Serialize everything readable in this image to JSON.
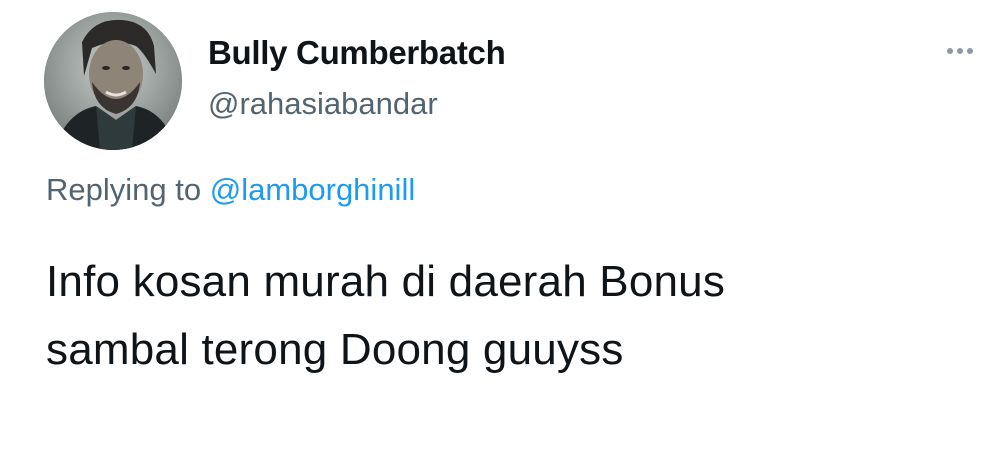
{
  "author": {
    "display_name": "Bully Cumberbatch",
    "handle": "@rahasiabandar"
  },
  "reply": {
    "prefix": "Replying to",
    "mention": "@lamborghinill"
  },
  "tweet": {
    "lines": [
      "Info kosan murah di daerah Bonus",
      "sambal terong Doong guuyss"
    ]
  },
  "icons": {
    "more": "more-horizontal-icon"
  },
  "colors": {
    "text": "#0f1419",
    "secondary": "#536471",
    "link": "#1d9bf0"
  }
}
